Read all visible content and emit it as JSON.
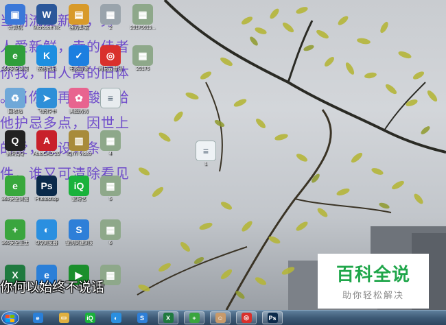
{
  "desktop_icons": [
    {
      "id": "computer",
      "label": "计算机",
      "icon": "computer-icon",
      "color": "#3b78d8",
      "glyph": "▣"
    },
    {
      "id": "word",
      "label": "Microsoft Word 2010",
      "icon": "word-icon",
      "color": "#2b579a",
      "glyph": "W"
    },
    {
      "id": "clean",
      "label": "强力卸载",
      "icon": "disk-icon",
      "color": "#d89a2a",
      "glyph": "▤"
    },
    {
      "id": "file2",
      "label": "2",
      "icon": "image-file-icon",
      "color": "#9aa4ac",
      "glyph": "▦"
    },
    {
      "id": "file20170619",
      "label": "20170619...",
      "icon": "image-file-icon",
      "color": "#8ea88a",
      "glyph": "▦"
    },
    {
      "id": "browser360",
      "label": "360安全浏览器",
      "icon": "browser-icon",
      "color": "#2f9e3a",
      "glyph": "e"
    },
    {
      "id": "kugou",
      "label": "酷狗音乐",
      "icon": "kugou-icon",
      "color": "#1d8fe0",
      "glyph": "K"
    },
    {
      "id": "safety",
      "label": "电脑管家",
      "icon": "shield-icon",
      "color": "#1c7fe0",
      "glyph": "✓"
    },
    {
      "id": "netease",
      "label": "网易云音乐",
      "icon": "music-icon",
      "color": "#d9302c",
      "glyph": "◎"
    },
    {
      "id": "file20176",
      "label": "20176",
      "icon": "image-file-icon",
      "color": "#8ea88a",
      "glyph": "▦"
    },
    {
      "id": "recycle",
      "label": "回收站",
      "icon": "recycle-bin-icon",
      "color": "#6fa8d8",
      "glyph": "♻"
    },
    {
      "id": "feige",
      "label": "飞鸽传书",
      "icon": "bird-icon",
      "color": "#2e8fd8",
      "glyph": "➤"
    },
    {
      "id": "photos",
      "label": "美图秀秀",
      "icon": "flower-icon",
      "color": "#e8648f",
      "glyph": "✿"
    },
    {
      "id": "txtfile",
      "label": "",
      "icon": "text-file-icon",
      "color": "#e8ecef",
      "glyph": "≡"
    },
    {
      "id": "qq",
      "label": "腾讯QQ",
      "icon": "qq-icon",
      "color": "#222222",
      "glyph": "Q"
    },
    {
      "id": "autocad",
      "label": "AutoCAD 2010",
      "icon": "autocad-icon",
      "color": "#c8202a",
      "glyph": "A"
    },
    {
      "id": "iqiyi_video",
      "label": "IQIYI Video",
      "icon": "film-icon",
      "color": "#a88b3a",
      "glyph": "▥"
    },
    {
      "id": "file4",
      "label": "4",
      "icon": "image-file-icon",
      "color": "#8ea88a",
      "glyph": "▦"
    },
    {
      "id": "browser360b",
      "label": "360安全浏览器",
      "icon": "browser-icon",
      "color": "#38a83c",
      "glyph": "e"
    },
    {
      "id": "photoshop",
      "label": "Photoshop",
      "icon": "photoshop-icon",
      "color": "#0b2a4a",
      "glyph": "Ps"
    },
    {
      "id": "iqiyi",
      "label": "爱奇艺",
      "icon": "iqiyi-icon",
      "color": "#19b23b",
      "glyph": "iQ"
    },
    {
      "id": "file5",
      "label": "5",
      "icon": "image-file-icon",
      "color": "#8ea88a",
      "glyph": "▦"
    },
    {
      "id": "guard360",
      "label": "360安全卫士",
      "icon": "plus-shield-icon",
      "color": "#3aa53e",
      "glyph": "+"
    },
    {
      "id": "qqbrowser",
      "label": "QQ浏览器",
      "icon": "qq-browser-icon",
      "color": "#2a8fe0",
      "glyph": "◐"
    },
    {
      "id": "sogou",
      "label": "搜狗高速浏览器",
      "icon": "sogou-icon",
      "color": "#2e7fd8",
      "glyph": "S"
    },
    {
      "id": "file6",
      "label": "6",
      "icon": "image-file-icon",
      "color": "#8ea88a",
      "glyph": "▦"
    },
    {
      "id": "excel",
      "label": "Excel 2010",
      "icon": "excel-icon",
      "color": "#1f7a3f",
      "glyph": "X"
    },
    {
      "id": "ie",
      "label": "",
      "icon": "ie-icon",
      "color": "#2a7fd8",
      "glyph": "e"
    },
    {
      "id": "media",
      "label": "台",
      "icon": "media-player-icon",
      "color": "#1b8f2c",
      "glyph": "▶"
    },
    {
      "id": "file7",
      "label": "",
      "icon": "image-file-icon",
      "color": "#8ea88a",
      "glyph": "▦"
    },
    {
      "id": "doc1",
      "label": "1",
      "icon": "document-icon",
      "color": "#eef2f5",
      "glyph": "≡"
    }
  ],
  "overlay_lines": [
    "当潮流爱新鲜，旁",
    "人爱新鲜，幸的佳者",
    "你我，旧人窝的旧体",
    "。当你不再心酸，给",
    "他护忌多点，因世上",
    "的爱，是设计条",
    "件，谁又可清除看见"
  ],
  "subtitle": "你何以始终不说话",
  "watermark": {
    "title": "百科全说",
    "subtitle": "助你轻松解决"
  },
  "taskbar": {
    "items": [
      {
        "id": "ie",
        "icon": "ie-icon",
        "color": "#2a7fd8",
        "glyph": "e"
      },
      {
        "id": "explorer",
        "icon": "folder-icon",
        "color": "#e0b040",
        "glyph": "▭"
      },
      {
        "id": "iqiyi",
        "icon": "iqiyi-icon",
        "color": "#19b23b",
        "glyph": "iQ"
      },
      {
        "id": "qqbrowser",
        "icon": "qq-browser-icon",
        "color": "#2a8fe0",
        "glyph": "◐"
      },
      {
        "id": "sogou",
        "icon": "sogou-icon",
        "color": "#2e7fd8",
        "glyph": "S"
      },
      {
        "id": "excel",
        "icon": "excel-icon",
        "color": "#1f7a3f",
        "glyph": "X"
      },
      {
        "id": "guard360",
        "icon": "plus-shield-icon",
        "color": "#3aa53e",
        "glyph": "+"
      },
      {
        "id": "avatar",
        "icon": "avatar-icon",
        "color": "#c89a6a",
        "glyph": "☺"
      },
      {
        "id": "netease",
        "icon": "music-icon",
        "color": "#d9302c",
        "glyph": "◎"
      },
      {
        "id": "photoshop",
        "icon": "photoshop-icon",
        "color": "#0b2a4a",
        "glyph": "Ps"
      }
    ],
    "active": [
      "excel",
      "guard360",
      "avatar",
      "netease",
      "photoshop"
    ]
  }
}
